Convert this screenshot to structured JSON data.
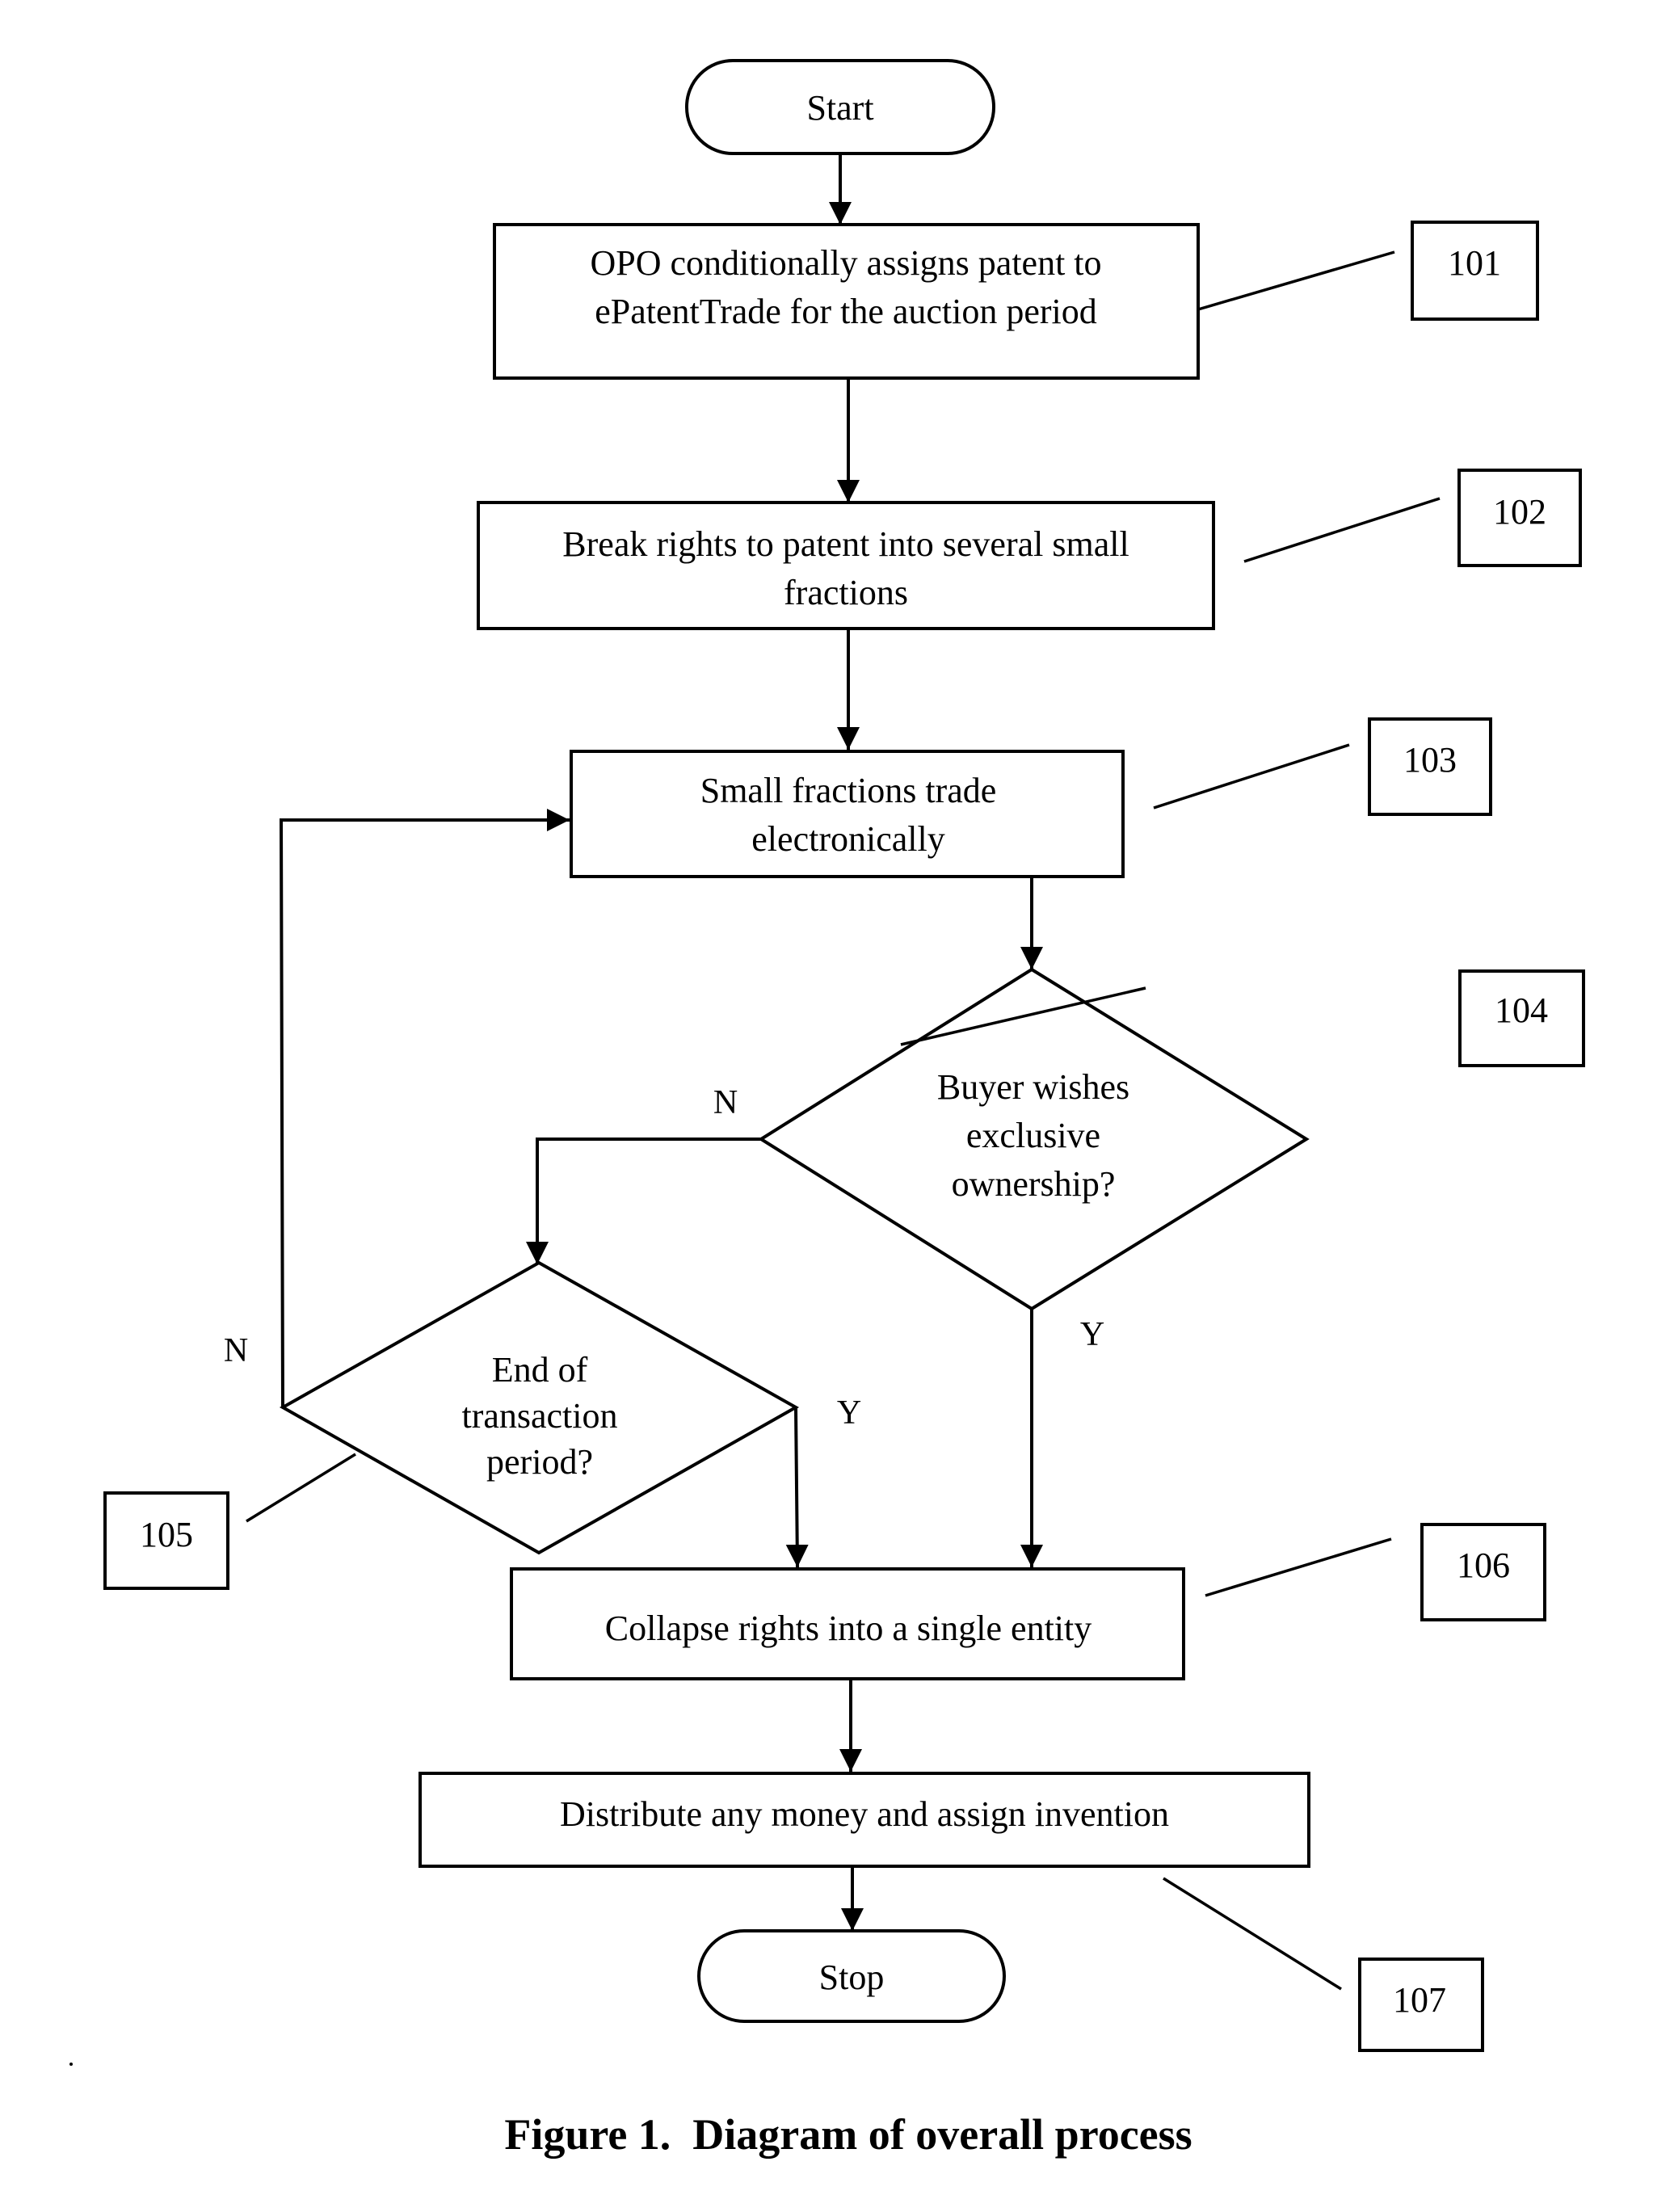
{
  "diagram": {
    "caption": "Figure 1.  Diagram of overall process",
    "nodes": {
      "start": {
        "label": "Start"
      },
      "step101": {
        "lines": [
          "OPO conditionally assigns patent to",
          "ePatentTrade for the auction period"
        ],
        "ref": "101"
      },
      "step102": {
        "lines": [
          "Break rights to patent into several small",
          "fractions"
        ],
        "ref": "102"
      },
      "step103": {
        "lines": [
          "Small fractions trade",
          "electronically"
        ],
        "ref": "103"
      },
      "decision104": {
        "lines": [
          "Buyer wishes",
          "exclusive",
          "ownership?"
        ],
        "ref": "104",
        "no_label": "N",
        "yes_label": "Y"
      },
      "decision105": {
        "lines": [
          "End of",
          "transaction",
          "period?"
        ],
        "ref": "105",
        "no_label": "N",
        "yes_label": "Y"
      },
      "step106": {
        "lines": [
          "Collapse rights into a single entity"
        ],
        "ref": "106"
      },
      "step107": {
        "lines": [
          "Distribute any money and assign invention"
        ],
        "ref": "107"
      },
      "stop": {
        "label": "Stop"
      }
    },
    "edges": [
      {
        "from": "start",
        "to": "step101"
      },
      {
        "from": "step101",
        "to": "step102"
      },
      {
        "from": "step102",
        "to": "step103"
      },
      {
        "from": "step103",
        "to": "decision104"
      },
      {
        "from": "decision104",
        "to": "decision105",
        "label": "N"
      },
      {
        "from": "decision104",
        "to": "step106",
        "label": "Y"
      },
      {
        "from": "decision105",
        "to": "step103",
        "label": "N"
      },
      {
        "from": "decision105",
        "to": "step106",
        "label": "Y"
      },
      {
        "from": "step106",
        "to": "step107"
      },
      {
        "from": "step107",
        "to": "stop"
      }
    ]
  }
}
